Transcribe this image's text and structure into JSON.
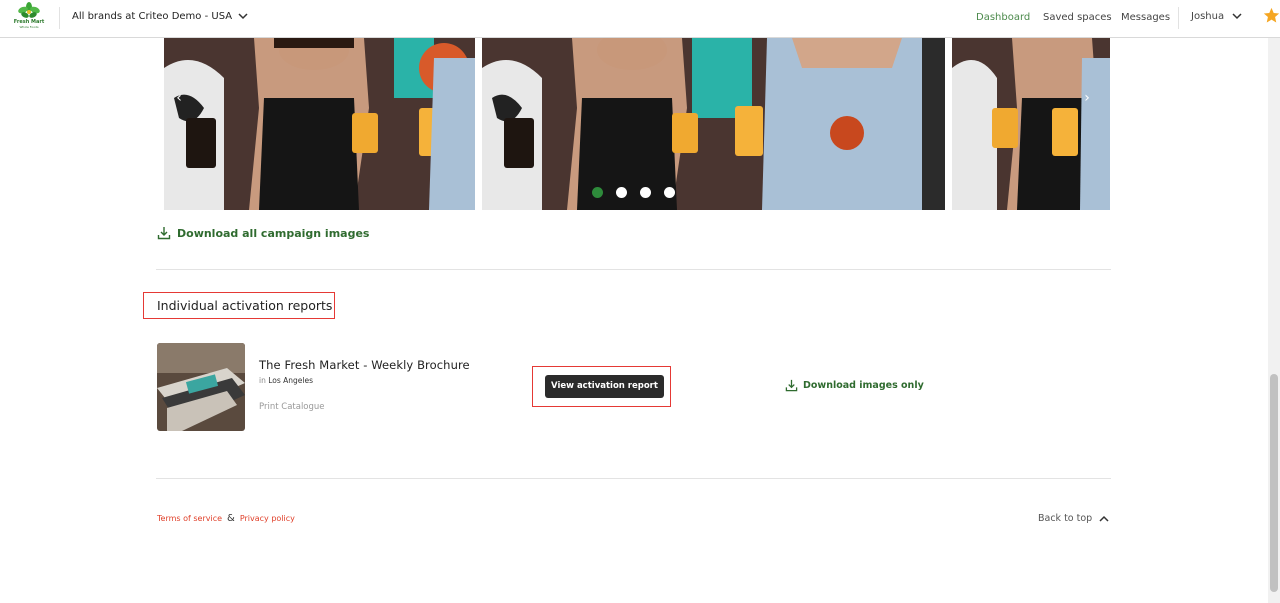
{
  "header": {
    "logo_text": "Fresh Mart",
    "logo_subtext": "Whole Foods",
    "brand_selector": "All brands at Criteo Demo - USA",
    "nav": [
      "Dashboard",
      "Saved spaces",
      "Messages"
    ],
    "active_nav": "Dashboard",
    "user": "Joshua"
  },
  "carousel": {
    "dots": 4,
    "active_dot": 1,
    "prev_arrow": "‹",
    "next_arrow": "›"
  },
  "download_all": "Download all campaign images",
  "section": {
    "title": "Individual activation reports"
  },
  "report": {
    "title": "The Fresh Market - Weekly Brochure",
    "location_prefix": "in",
    "location": "Los Angeles",
    "type": "Print Catalogue",
    "view_button": "View activation report",
    "download_images": "Download images only"
  },
  "footer": {
    "terms": "Terms of service",
    "amp": "&",
    "privacy": "Privacy policy",
    "back_to_top": "Back to top"
  },
  "colors": {
    "accent_green": "#2f6b2f",
    "active_dot": "#2e8b3b",
    "highlight_red": "#e53935",
    "link_red": "#e0402a",
    "star": "#f5a623"
  }
}
